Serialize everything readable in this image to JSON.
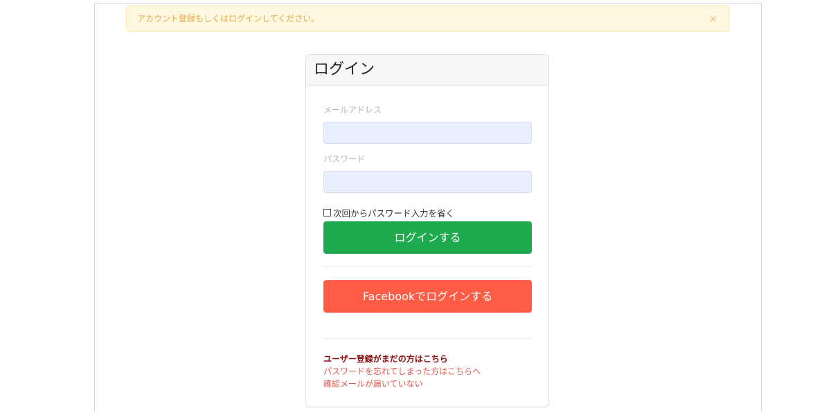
{
  "alert": {
    "message": "アカウント登録もしくはログインしてください。",
    "close": "×"
  },
  "card": {
    "title": "ログイン"
  },
  "form": {
    "email_label": "メールアドレス",
    "email_value": "",
    "password_label": "パスワード",
    "password_value": "",
    "remember_label": "次回からパスワード入力を省く",
    "login_button": "ログインする",
    "facebook_button": "Facebookでログインする"
  },
  "links": {
    "register": "ユーザー登録がまだの方はこちら",
    "forgot_password": "パスワードを忘れてしまった方はこちらへ",
    "confirm_email": "確認メールが届いていない"
  },
  "colors": {
    "login_green": "#1faa4f",
    "facebook_orange": "#ff5c45",
    "alert_bg": "#fff8e1",
    "link_red": "#e6554c",
    "link_dark_red": "#8b0d0d"
  }
}
